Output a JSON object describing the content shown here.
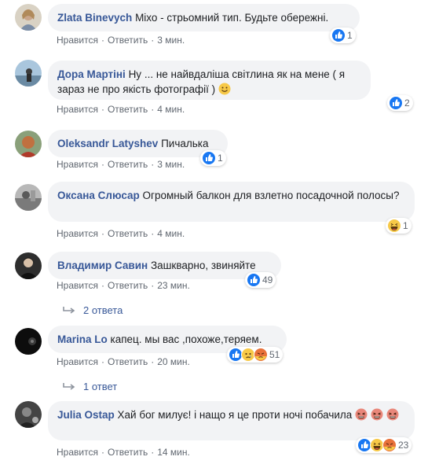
{
  "actions": {
    "like": "Нравится",
    "reply": "Ответить",
    "sep": "·"
  },
  "colors": {
    "author": "#385898",
    "bubble": "#f2f3f5",
    "like_blue": "#1877f2"
  },
  "comments": [
    {
      "author": "Zlata Binevych",
      "text": "Міхо - стрьомний тип. Будьте обережні.",
      "time": "3 мин.",
      "reaction_count": "1",
      "reactions": [
        "like-icon"
      ]
    },
    {
      "author": "Дора Мартіні",
      "text": "Ну ... не найвдаліша світлина як на мене ( я зараз не про якість фотографії )",
      "time": "4 мин.",
      "reaction_count": "2",
      "reactions": [
        "like-icon"
      ],
      "inline_emoji": "smiling-face-emoji"
    },
    {
      "author": "Oleksandr Latyshev",
      "text": "Пичалька",
      "time": "3 мин.",
      "reaction_count": "1",
      "reactions": [
        "like-icon"
      ]
    },
    {
      "author": "Оксана Слюсар",
      "text": "Огромный балкон для взлетно посадочной полосы?",
      "time": "4 мин.",
      "reaction_count": "1",
      "reactions": [
        "haha-icon"
      ]
    },
    {
      "author": "Владимир Савин",
      "text": "Зашкварно, звиняйте",
      "time": "23 мин.",
      "reaction_count": "49",
      "reactions": [
        "like-icon"
      ],
      "replies": "2 ответа"
    },
    {
      "author": "Marina Lo",
      "text": "капец. мы вас ,похоже,теряем.",
      "time": "20 мин.",
      "reaction_count": "51",
      "reactions": [
        "like-icon",
        "sad-icon",
        "angry-icon"
      ],
      "replies": "1 ответ"
    },
    {
      "author": "Julia Ostap",
      "text": "Хай бог милує! і нащо я це проти ночі побачила",
      "time": "14 мин.",
      "reaction_count": "23",
      "reactions": [
        "like-icon",
        "haha-icon",
        "angry-icon"
      ],
      "inline_emoji": "tired-face-emoji"
    }
  ]
}
